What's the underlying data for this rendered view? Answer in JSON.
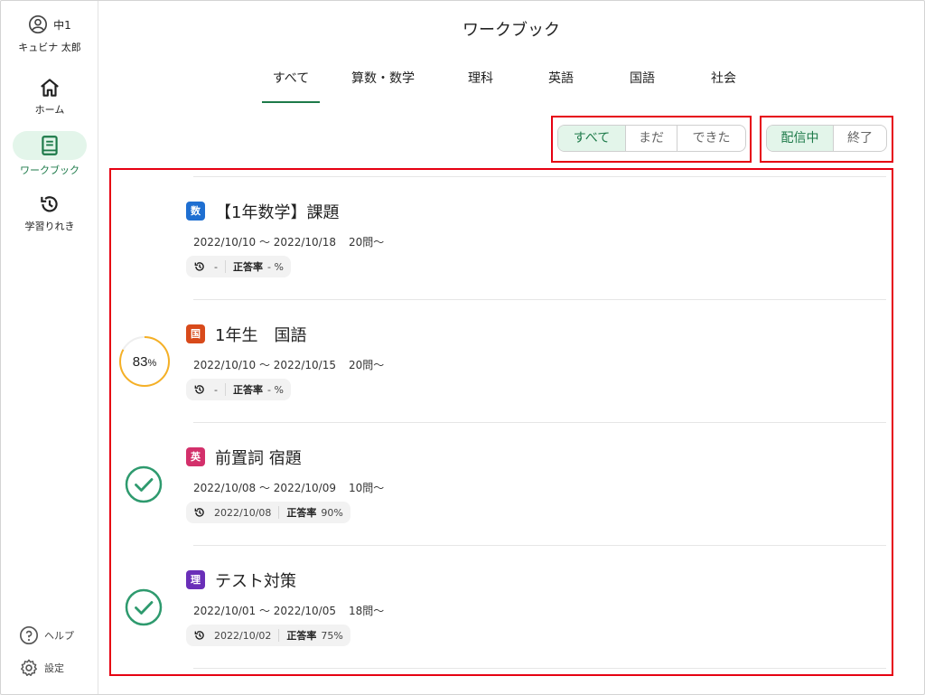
{
  "sidebar": {
    "grade": "中1",
    "user_name": "キュビナ 太郎",
    "nav": [
      {
        "label": "ホーム",
        "icon": "home-icon"
      },
      {
        "label": "ワークブック",
        "icon": "book-icon"
      },
      {
        "label": "学習りれき",
        "icon": "history-icon"
      }
    ],
    "help_label": "ヘルプ",
    "settings_label": "設定"
  },
  "header": {
    "title": "ワークブック",
    "tabs": [
      "すべて",
      "算数・数学",
      "理科",
      "英語",
      "国語",
      "社会"
    ]
  },
  "filters": {
    "progress": [
      "すべて",
      "まだ",
      "できた"
    ],
    "delivery": [
      "配信中",
      "終了"
    ]
  },
  "items": [
    {
      "subject": "数",
      "subject_color": "#1f6fd1",
      "title": "【1年数学】課題",
      "period": "2022/10/10 〜 2022/10/18",
      "count": "20問〜",
      "last_study": "-",
      "accuracy_label": "正答率",
      "accuracy": "- %",
      "status": "none"
    },
    {
      "subject": "国",
      "subject_color": "#d84a1b",
      "title": "1年生　国語",
      "period": "2022/10/10 〜 2022/10/15",
      "count": "20問〜",
      "last_study": "-",
      "accuracy_label": "正答率",
      "accuracy": "- %",
      "status": "progress",
      "progress_text": "83",
      "progress_unit": "%",
      "progress": 0.83
    },
    {
      "subject": "英",
      "subject_color": "#d3306b",
      "title": "前置詞 宿題",
      "period": "2022/10/08 〜 2022/10/09",
      "count": "10問〜",
      "last_study": "2022/10/08",
      "accuracy_label": "正答率",
      "accuracy": "90%",
      "status": "done"
    },
    {
      "subject": "理",
      "subject_color": "#6a2fb8",
      "title": "テスト対策",
      "period": "2022/10/01 〜 2022/10/05",
      "count": "18問〜",
      "last_study": "2022/10/02",
      "accuracy_label": "正答率",
      "accuracy": "75%",
      "status": "done"
    }
  ],
  "colors": {
    "accent": "#1d7a49",
    "highlight": "#e60012",
    "progress_ring": "#f5b026",
    "check": "#2e9a6e"
  }
}
